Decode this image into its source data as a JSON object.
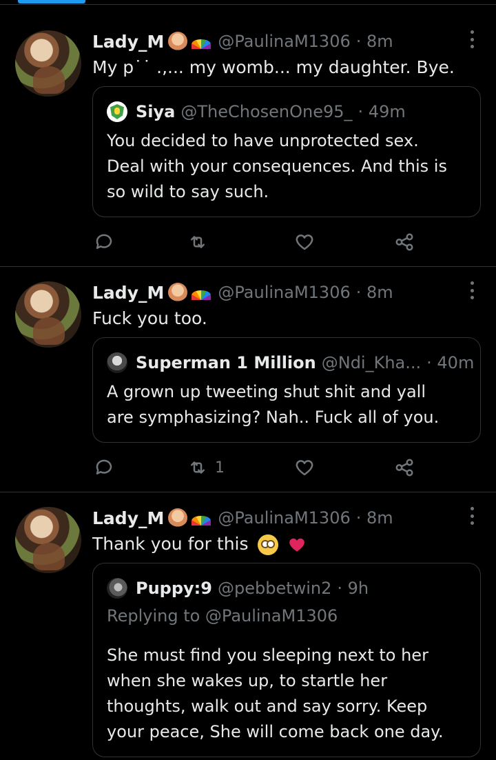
{
  "tweets": [
    {
      "display_name": "Lady_M",
      "handle": "@PaulinaM1306",
      "time": "· 8m",
      "text": "My p˙˙ .,... my womb... my daughter. Bye.",
      "quote": {
        "name": "Siya",
        "handle": "@TheChosenOne95_",
        "time": "· 49m",
        "lines": [
          "You decided to have unprotected sex.",
          "Deal with your consequences. And this is",
          "so wild to say such."
        ]
      },
      "retweet_count": ""
    },
    {
      "display_name": "Lady_M",
      "handle": "@PaulinaM1306",
      "time": "· 8m",
      "text": "Fuck you too.",
      "quote": {
        "name": "Superman 1 Million",
        "handle": "@Ndi_Kha...",
        "time": "· 40m",
        "lines": [
          "A grown up tweeting shut shit and yall",
          "are symphasizing? Nah.. Fuck all of you."
        ]
      },
      "retweet_count": "1"
    },
    {
      "display_name": "Lady_M",
      "handle": "@PaulinaM1306",
      "time": "· 8m",
      "text": "Thank you for this",
      "quote": {
        "name": "Puppy:9",
        "handle": "@pebbetwin2",
        "time": "· 9h",
        "replying": "Replying to @PaulinaM1306",
        "lines": [
          "She must find you sleeping next to her",
          "when she wakes up, to startle her",
          "thoughts, walk out and say sorry. Keep",
          "your peace, She will come back one day."
        ]
      }
    }
  ],
  "icons": {
    "reply": "reply-icon",
    "retweet": "retweet-icon",
    "like": "heart-icon",
    "share": "share-icon",
    "more": "more-icon"
  },
  "colors": {
    "background": "#000000",
    "text": "#e7e9ea",
    "secondary": "#71767b",
    "border": "#2f3336",
    "accent": "#1d9bf0",
    "heart_emoji": "#e0245e"
  }
}
